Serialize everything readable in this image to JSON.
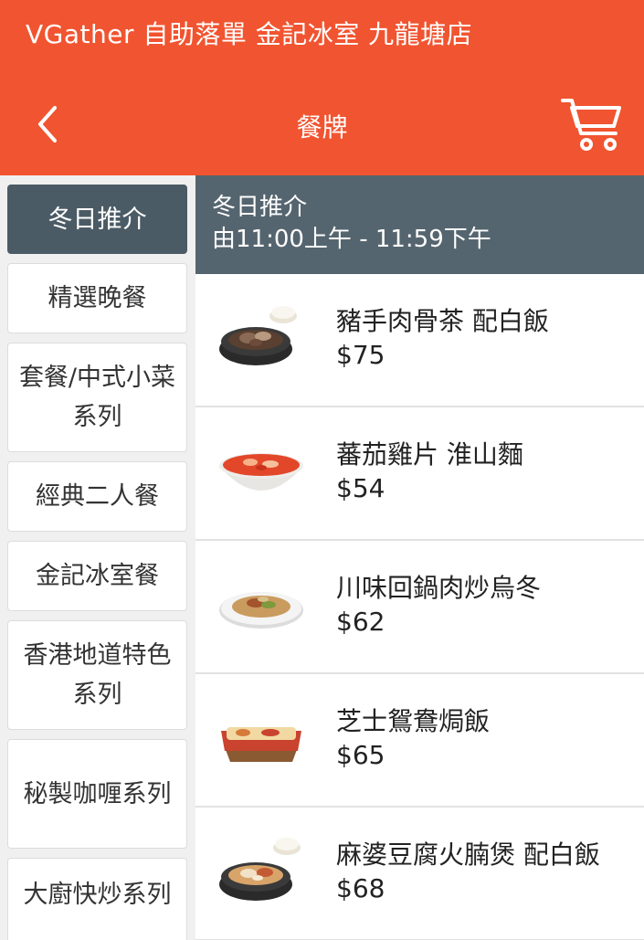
{
  "header": {
    "app_title": "VGather 自助落單 金記冰室 九龍塘店",
    "page_title": "餐牌"
  },
  "sidebar": {
    "categories": [
      {
        "label": "冬日推介"
      },
      {
        "label": "精選晚餐"
      },
      {
        "label": "套餐/中式小菜系列"
      },
      {
        "label": "經典二人餐"
      },
      {
        "label": "金記冰室餐"
      },
      {
        "label": "香港地道特色系列"
      },
      {
        "label": "秘製咖喱系列"
      },
      {
        "label": "大廚快炒系列"
      }
    ]
  },
  "section": {
    "title": "冬日推介",
    "hours": "由11:00上午 - 11:59下午"
  },
  "items": [
    {
      "name": "豬手肉骨茶 配白飯",
      "price": "$75",
      "icon": "claypot-with-rice"
    },
    {
      "name": "蕃茄雞片 淮山麵",
      "price": "$54",
      "icon": "tomato-noodle-bowl"
    },
    {
      "name": "川味回鍋肉炒烏冬",
      "price": "$62",
      "icon": "udon-plate"
    },
    {
      "name": "芝士鴛鴦焗飯",
      "price": "$65",
      "icon": "baked-rice-dish"
    },
    {
      "name": "麻婆豆腐火腩煲 配白飯",
      "price": "$68",
      "icon": "claypot-with-rice"
    }
  ],
  "colors": {
    "brand": "#f15430",
    "active_category": "#4b5b65",
    "section_header": "#55656f"
  }
}
